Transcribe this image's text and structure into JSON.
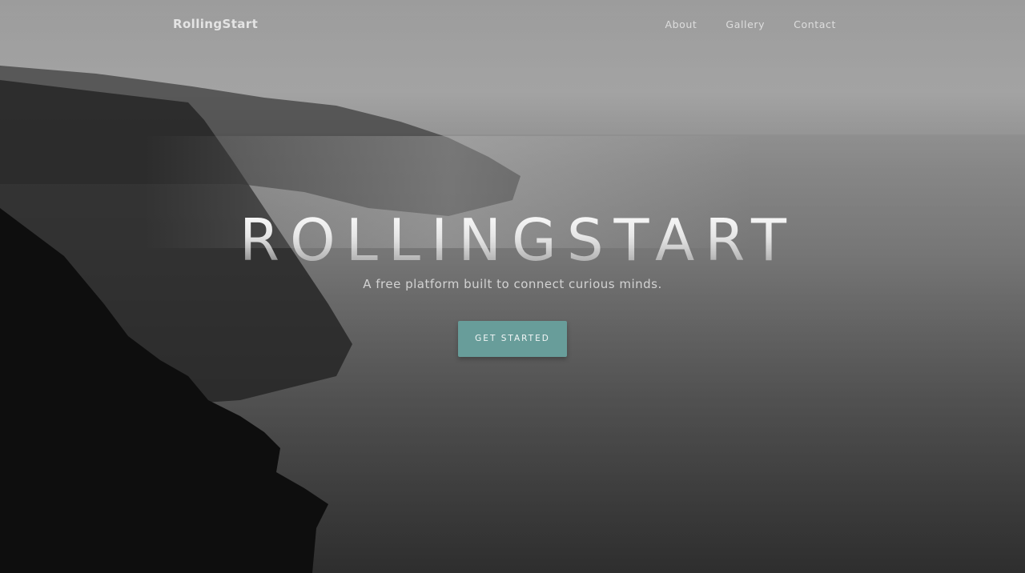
{
  "navbar": {
    "brand": "RollingStart",
    "links": [
      {
        "label": "About"
      },
      {
        "label": "Gallery"
      },
      {
        "label": "Contact"
      }
    ]
  },
  "hero": {
    "title": "ROLLINGSTART",
    "subtitle": "A free platform built to connect curious minds.",
    "cta_label": "GET STARTED"
  },
  "colors": {
    "accent": "#689d9a",
    "sky": "#a6a6a6",
    "cliff": "#0e0e0e"
  }
}
